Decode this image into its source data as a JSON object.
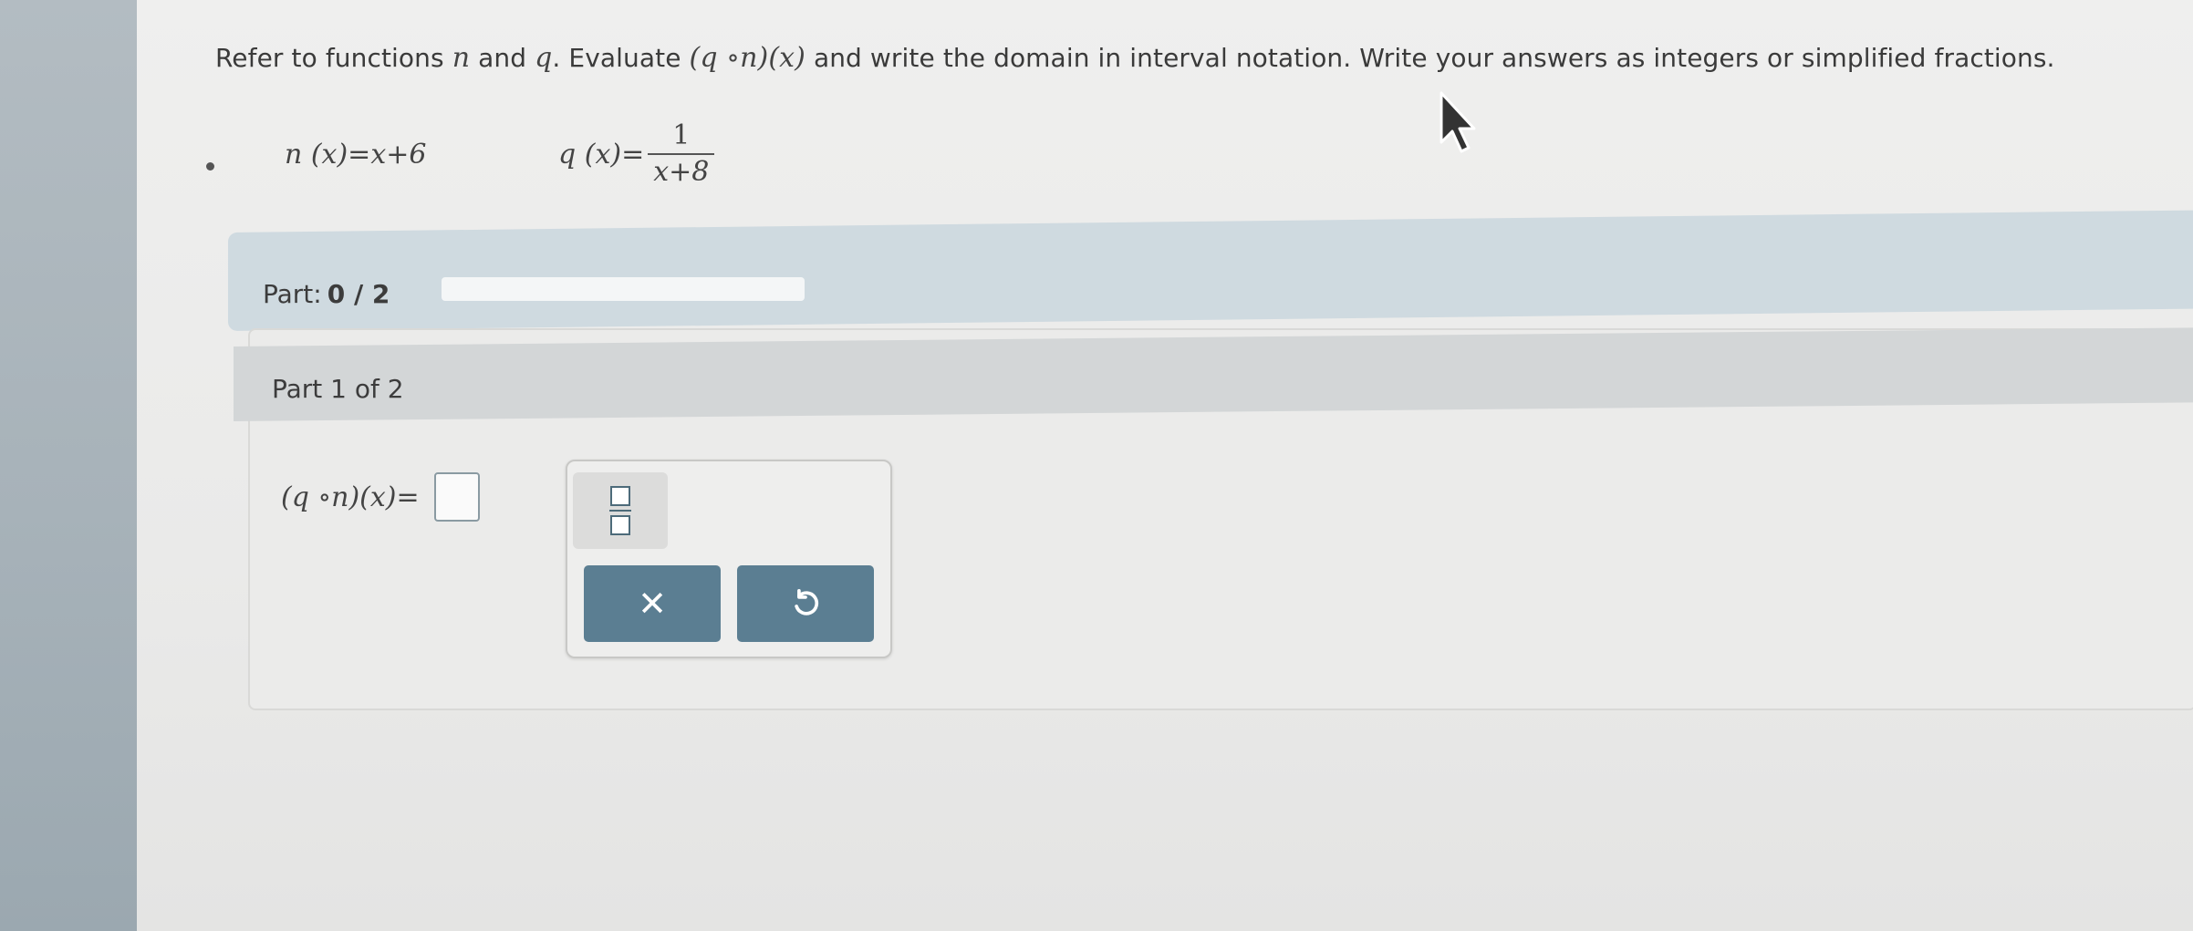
{
  "prompt": {
    "text_1": "Refer to functions ",
    "var_n": "n",
    "text_and": " and ",
    "var_q": "q",
    "text_2": ". Evaluate ",
    "composition": "(q ∘n)(x)",
    "text_3": " and write the domain in interval notation. Write your answers as integers or simplified fractions."
  },
  "functions": {
    "n_def": "n (x)=x+6",
    "q_lhs": "q (x)=",
    "q_num": "1",
    "q_den": "x+8"
  },
  "progress": {
    "label": "Part:",
    "value": "0 / 2",
    "completed_fraction": 0
  },
  "part": {
    "heading": "Part 1 of 2",
    "answer_lhs": "(q ∘n)(x)="
  },
  "tools": {
    "fraction_icon": "fraction-icon",
    "clear_icon": "close-icon",
    "clear_symbol": "✕",
    "undo_icon": "undo-icon"
  },
  "colors": {
    "button": "#5b7e92",
    "part_bar": "#cfdae0"
  }
}
